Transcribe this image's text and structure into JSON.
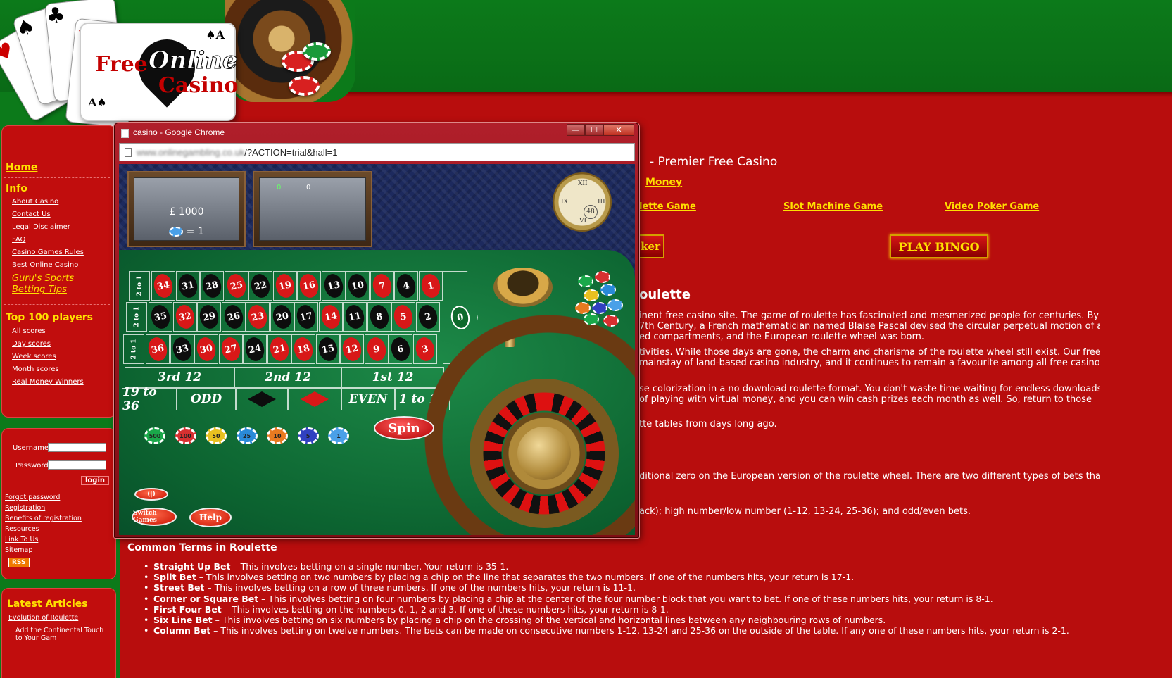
{
  "logo": {
    "word1": "Free",
    "word2": "Online",
    "word3": "Casino"
  },
  "sidebar": {
    "home": "Home",
    "info_head": "Info",
    "info_links": [
      "About Casino",
      "Contact Us",
      "Legal Disclaimer",
      "FAQ",
      "Casino Games Rules",
      "Best Online Casino"
    ],
    "guru": "Guru's Sports Betting Tips",
    "top_head": "Top 100 players",
    "top_links": [
      "All scores",
      "Day scores",
      "Week scores",
      "Month scores",
      "Real Money Winners"
    ],
    "login": {
      "username_label": "Username:",
      "password_label": "Password:",
      "login_button": "login"
    },
    "small_links": [
      "Forgot password",
      "Registration",
      "Benefits of registration",
      "Resources",
      "Link To Us",
      "Sitemap"
    ],
    "rss": "RSS",
    "latest_head": "Latest Articles",
    "latest_links": [
      "Evolution of Roulette",
      "Add the Continental Touch to Your Gam"
    ]
  },
  "main": {
    "heading": "- Premier Free Casino",
    "money_link": "Money",
    "game_links": [
      "lette Game",
      "Slot Machine Game",
      "Video Poker Game"
    ],
    "poker_partial": "ker",
    "bingo_button": "PLAY BINGO",
    "section_title": "oulette",
    "paragraph_lines": [
      "inent free casino site. The game of roulette has fascinated and mesmerized people for centuries. By",
      "7th Century, a French mathematician named Blaise Pascal devised the circular perpetual motion of a",
      "ed compartments, and the European roulette wheel was born.",
      "tivities. While those days are gone, the charm and charisma of the roulette wheel still exist. Our free",
      "mainstay of land-based casino industry, and it continues to remain a favourite among all free casino",
      "se colorization in a no download roulette format. You don't waste time waiting for endless downloads",
      "of playing with virtual money, and you can win cash prizes each month as well. So, return to those",
      "tte tables from days long ago.",
      "ditional zero on the European version of the roulette wheel. There are two different types of bets that",
      "ack); high number/low number (1-12, 13-24, 25-36); and odd/even bets."
    ],
    "terms_title": "Common Terms in Roulette",
    "terms": [
      {
        "term": "Straight Up Bet",
        "desc": " – This involves betting on a single number. Your return is 35-1."
      },
      {
        "term": "Split Bet",
        "desc": " – This involves betting on two numbers by placing a chip on the line that separates the two numbers. If one of the numbers hits, your return is 17-1."
      },
      {
        "term": "Street Bet",
        "desc": " – This involves betting on a row of three numbers. If one of the numbers hits, your return is 11-1."
      },
      {
        "term": "Corner or Square Bet",
        "desc": " – This involves betting on four numbers by placing a chip at the center of the four number block that you want to bet. If one of these numbers hits, your return is 8-1."
      },
      {
        "term": "First Four Bet",
        "desc": " – This involves betting on the numbers 0, 1, 2 and 3. If one of these numbers hits, your return is 8-1."
      },
      {
        "term": "Six Line Bet",
        "desc": " – This involves betting on six numbers by placing a chip on the crossing of the vertical and horizontal lines between any neighbouring rows of numbers."
      },
      {
        "term": "Column Bet",
        "desc": " – This involves betting on twelve numbers. The bets can be made on consecutive numbers 1-12, 13-24 and 25-36 on the outside of the table. If any one of these numbers hits, your return is 2-1."
      }
    ]
  },
  "popup": {
    "title": "casino - Google Chrome",
    "url_hidden": "www.onlinegambling.co.uk",
    "url_visible": "/?ACTION=trial&hall=1",
    "minimize": "—",
    "maximize": "☐",
    "close": "✕"
  },
  "game": {
    "balance": "£ 1000",
    "chip_value": "= 1",
    "last_win_a": "0",
    "last_win_b": "0",
    "clock_numbers": [
      "XII",
      "III",
      "IX",
      "VI"
    ],
    "clock_sub": "48",
    "rows": [
      [
        {
          "n": "34",
          "c": "red"
        },
        {
          "n": "31",
          "c": "black"
        },
        {
          "n": "28",
          "c": "black"
        },
        {
          "n": "25",
          "c": "red"
        },
        {
          "n": "22",
          "c": "black"
        },
        {
          "n": "19",
          "c": "red"
        },
        {
          "n": "16",
          "c": "red"
        },
        {
          "n": "13",
          "c": "black"
        },
        {
          "n": "10",
          "c": "black"
        },
        {
          "n": "7",
          "c": "red"
        },
        {
          "n": "4",
          "c": "black"
        },
        {
          "n": "1",
          "c": "red"
        }
      ],
      [
        {
          "n": "35",
          "c": "black"
        },
        {
          "n": "32",
          "c": "red"
        },
        {
          "n": "29",
          "c": "black"
        },
        {
          "n": "26",
          "c": "black"
        },
        {
          "n": "23",
          "c": "red"
        },
        {
          "n": "20",
          "c": "black"
        },
        {
          "n": "17",
          "c": "black"
        },
        {
          "n": "14",
          "c": "red"
        },
        {
          "n": "11",
          "c": "black"
        },
        {
          "n": "8",
          "c": "black"
        },
        {
          "n": "5",
          "c": "red"
        },
        {
          "n": "2",
          "c": "black"
        }
      ],
      [
        {
          "n": "36",
          "c": "red"
        },
        {
          "n": "33",
          "c": "black"
        },
        {
          "n": "30",
          "c": "red"
        },
        {
          "n": "27",
          "c": "red"
        },
        {
          "n": "24",
          "c": "black"
        },
        {
          "n": "21",
          "c": "red"
        },
        {
          "n": "18",
          "c": "red"
        },
        {
          "n": "15",
          "c": "black"
        },
        {
          "n": "12",
          "c": "red"
        },
        {
          "n": "9",
          "c": "red"
        },
        {
          "n": "6",
          "c": "black"
        },
        {
          "n": "3",
          "c": "red"
        }
      ]
    ],
    "column_bets": [
      "2 to 1",
      "2 to 1",
      "2 to 1"
    ],
    "zero": "0",
    "dozens": [
      "3rd 12",
      "2nd 12",
      "1st 12"
    ],
    "outside": [
      "19 to 36",
      "ODD",
      "EVEN",
      "1 to 18"
    ],
    "chips": [
      "500",
      "100",
      "50",
      "25",
      "10",
      "5",
      "1"
    ],
    "chip_colors": [
      "#1aa84a",
      "#d83030",
      "#e8c020",
      "#2a8ad8",
      "#e87a20",
      "#3040c0",
      "#4aa0e8"
    ],
    "spin": "Spin",
    "switch_games": "Switch Games",
    "help": "Help",
    "small_btn": "(|)"
  }
}
